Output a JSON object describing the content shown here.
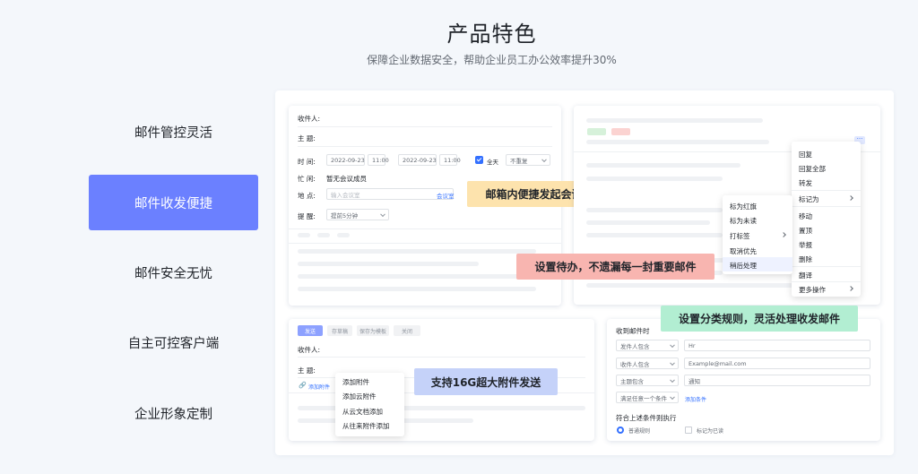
{
  "header": {
    "title": "产品特色",
    "subtitle": "保障企业数据安全，帮助企业员工办公效率提升30%"
  },
  "features": [
    {
      "label": "邮件管控灵活"
    },
    {
      "label": "邮件收发便捷"
    },
    {
      "label": "邮件安全无忧"
    },
    {
      "label": "自主可控客户端"
    },
    {
      "label": "企业形象定制"
    }
  ],
  "meeting": {
    "recipient_label": "收件人:",
    "subject_label": "主    题:",
    "time_label": "时    间:",
    "start_date": "2022-09-23",
    "start_time": "11:00",
    "end_date": "2022-09-23",
    "end_time": "11:00",
    "allday_label": "全天",
    "repeat_value": "不重复",
    "busy_label": "忙    闲:",
    "busy_value": "暂无会议成员",
    "place_label": "地    点:",
    "place_placeholder": "输入会议室",
    "room_link": "会议室",
    "remind_label": "提    醒:",
    "remind_value": "提前5分钟",
    "tooltip": "邮箱内便捷发起会议邀请"
  },
  "mail_menu": {
    "items": [
      "回复",
      "回复全部",
      "转发",
      "标记为",
      "移动",
      "置顶",
      "举报",
      "删除",
      "翻译",
      "更多操作"
    ],
    "submenu": [
      "标为红旗",
      "标为未读",
      "打标签",
      "取消优先",
      "稍后处理"
    ],
    "tooltip": "设置待办，不遗漏每一封重要邮件"
  },
  "compose": {
    "tabs": [
      "发送",
      "存草稿",
      "保存为模板",
      "关闭"
    ],
    "recipient_label": "收件人:",
    "subject_label": "主    题:",
    "attach_link": "添加附件",
    "attach_menu": [
      "添加附件",
      "添加云附件",
      "从云文档添加",
      "从往来附件添加"
    ],
    "tooltip": "支持16G超大附件发送"
  },
  "rules": {
    "header": "收到邮件时",
    "rows": [
      {
        "field": "发件人包含",
        "value": "Hr"
      },
      {
        "field": "收件人包含",
        "value": "Example@mail.com"
      },
      {
        "field": "主题包含",
        "value": "通知"
      }
    ],
    "condition_select": "满足任意一个条件",
    "add_condition": "添加条件",
    "execute_label": "符合上述条件则执行",
    "option_normal": "普通规则",
    "option_mark_read": "标记为已读",
    "tooltip": "设置分类规则，灵活处理收发邮件"
  },
  "colors": {
    "active_feature": "#6b80ff",
    "tip_yellow": "#fde3ad",
    "tip_red": "#f8b5b0",
    "tip_blue": "#c5d2f9",
    "tip_green": "#b2eed2",
    "link_blue": "#3370ff"
  }
}
